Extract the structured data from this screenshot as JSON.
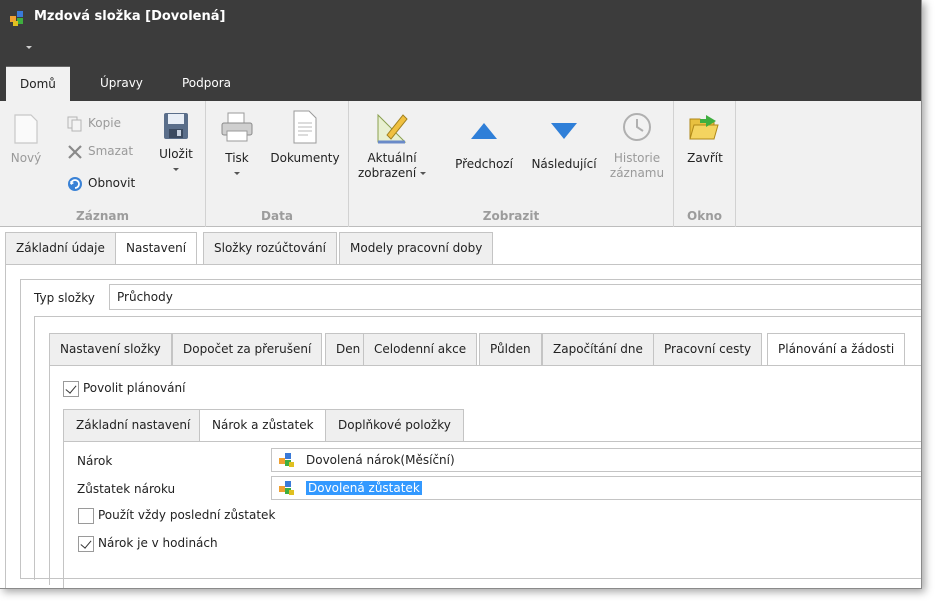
{
  "window": {
    "title": "Mzdová složka [Dovolená]"
  },
  "ribbon_tabs": [
    "Domů",
    "Úpravy",
    "Podpora"
  ],
  "ribbon": {
    "zaznam": {
      "label": "Záznam",
      "novy": "Nový",
      "kopie": "Kopie",
      "smazat": "Smazat",
      "obnovit": "Obnovit",
      "ulozit": "Uložit"
    },
    "data": {
      "label": "Data",
      "tisk": "Tisk",
      "dokumenty": "Dokumenty"
    },
    "zobrazit": {
      "label": "Zobrazit",
      "aktualni_1": "Aktuální",
      "aktualni_2": "zobrazení",
      "predchozi": "Předchozí",
      "nasledujici": "Následující",
      "historie_1": "Historie",
      "historie_2": "záznamu"
    },
    "okno": {
      "label": "Okno",
      "zavrit": "Zavřít"
    }
  },
  "page_tabs": [
    "Základní údaje",
    "Nastavení",
    "Složky rozúčtování",
    "Modely pracovní doby"
  ],
  "typ_slozky": {
    "label": "Typ složky",
    "value": "Průchody"
  },
  "inner_tabs": [
    "Nastavení složky",
    "Dopočet za přerušení",
    "Den",
    "Celodenní akce",
    "Půlden",
    "Započítání dne",
    "Pracovní cesty",
    "Plánování a žádosti"
  ],
  "povolit_planovani": "Povolit plánování",
  "sub_tabs": [
    "Základní nastavení",
    "Nárok a zůstatek",
    "Doplňkové položky"
  ],
  "fields": {
    "narok_label": "Nárok",
    "narok_value": "Dovolená nárok(Měsíční)",
    "zustatek_label": "Zůstatek nároku",
    "zustatek_value": "Dovolená zůstatek",
    "pouzit_posledni": "Použít vždy poslední zůstatek",
    "narok_hodiny": "Nárok je v hodinách"
  }
}
